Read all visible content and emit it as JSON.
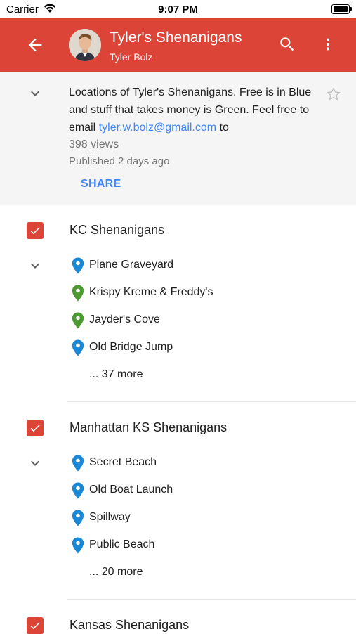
{
  "status_bar": {
    "carrier": "Carrier",
    "time": "9:07 PM"
  },
  "header": {
    "title": "Tyler's Shenanigans",
    "subtitle": "Tyler Bolz",
    "bg_color": "#db4437"
  },
  "description": {
    "text_before_link": "Locations of Tyler's Shenanigans. Free is in Blue and stuff that takes money is Green. Feel free to email ",
    "email": "tyler.w.bolz@gmail.com",
    "text_after_link": " to",
    "views": "398 views",
    "published": "Published 2 days ago",
    "share_label": "SHARE"
  },
  "colors": {
    "accent": "#db4437",
    "free_pin": "#1a88d4",
    "paid_pin": "#4e9a32",
    "link": "#4285f4"
  },
  "layers": [
    {
      "title": "KC Shenanigans",
      "places": [
        {
          "name": "Plane Graveyard",
          "pin": "blue"
        },
        {
          "name": "Krispy Kreme & Freddy's",
          "pin": "green"
        },
        {
          "name": "Jayder's Cove",
          "pin": "green"
        },
        {
          "name": "Old Bridge Jump",
          "pin": "blue"
        }
      ],
      "more": "... 37 more"
    },
    {
      "title": "Manhattan KS Shenanigans",
      "places": [
        {
          "name": "Secret Beach",
          "pin": "blue"
        },
        {
          "name": "Old Boat Launch",
          "pin": "blue"
        },
        {
          "name": "Spillway",
          "pin": "blue"
        },
        {
          "name": "Public Beach",
          "pin": "blue"
        }
      ],
      "more": "... 20 more"
    },
    {
      "title": "Kansas Shenanigans"
    }
  ]
}
